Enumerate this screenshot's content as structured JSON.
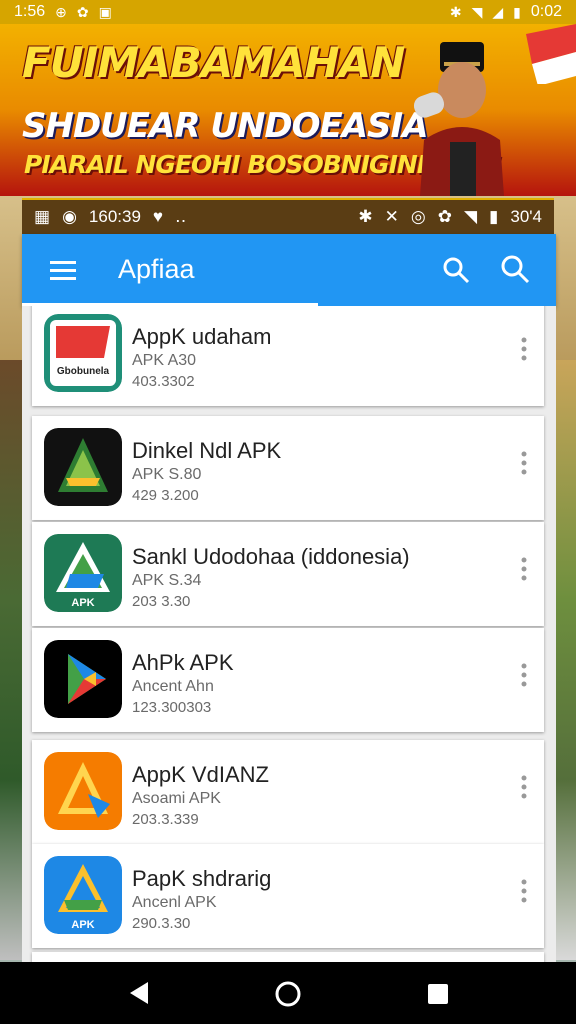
{
  "status_bar": {
    "time": "1:56",
    "clock": "0:02"
  },
  "banner": {
    "line1": "FUIMABAMAHAN",
    "line2": "SHDUEAR UNDOEASIA",
    "line3": "PIARAIL NGEOHI BOSOBNIGINFGAN!"
  },
  "secondary_status": {
    "time": "160:39",
    "battery": "30'4"
  },
  "app_bar": {
    "title": "Apfiaa"
  },
  "apps": [
    {
      "name": "AppK udaham",
      "sub": "APK A30",
      "meta": "403.3302",
      "icon_text": "Gbobunela",
      "icon_color": "#e53935"
    },
    {
      "name": "Dinkel Ndl APK",
      "sub": "APK S.80",
      "meta": "429 3.200",
      "icon_color": "#2e7d32"
    },
    {
      "name": "Sankl Udodohaa (iddonesia)",
      "sub": "APK S.34",
      "meta": "203 3.30",
      "icon_text": "APK",
      "icon_color": "#1e7a55"
    },
    {
      "name": "AhPk APK",
      "sub": "Ancent Ahn",
      "meta": "123.300303",
      "icon_color": "#000000"
    },
    {
      "name": "AppK VdIANZ",
      "sub": "Asoami APK",
      "meta": "203.3.339",
      "icon_color": "#f57c00"
    },
    {
      "name": "PapK shdrarig",
      "sub": "Ancenl APK",
      "meta": "290.3.30",
      "icon_text": "APK",
      "icon_color": "#1e88e5"
    }
  ]
}
